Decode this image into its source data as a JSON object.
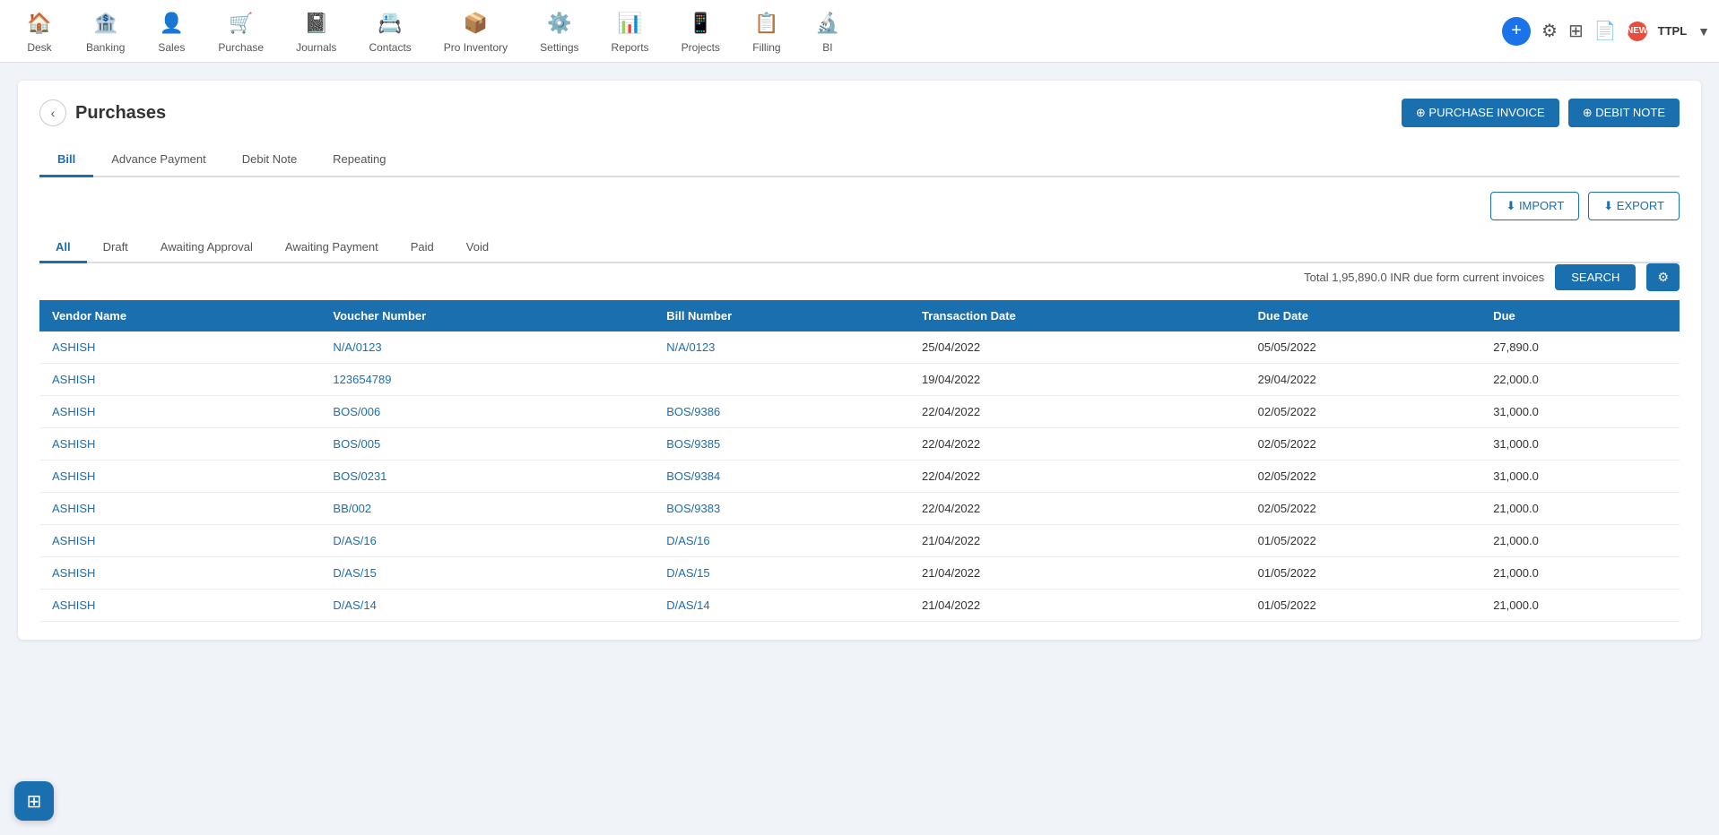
{
  "nav": {
    "items": [
      {
        "id": "desk",
        "label": "Desk",
        "icon": "🏠"
      },
      {
        "id": "banking",
        "label": "Banking",
        "icon": "🏦"
      },
      {
        "id": "sales",
        "label": "Sales",
        "icon": "👤"
      },
      {
        "id": "purchase",
        "label": "Purchase",
        "icon": "🛒"
      },
      {
        "id": "journals",
        "label": "Journals",
        "icon": "📓"
      },
      {
        "id": "contacts",
        "label": "Contacts",
        "icon": "📇"
      },
      {
        "id": "pro-inventory",
        "label": "Pro Inventory",
        "icon": "📦"
      },
      {
        "id": "settings",
        "label": "Settings",
        "icon": "⚙️"
      },
      {
        "id": "reports",
        "label": "Reports",
        "icon": "📊"
      },
      {
        "id": "projects",
        "label": "Projects",
        "icon": "📱"
      },
      {
        "id": "filling",
        "label": "Filling",
        "icon": "📋"
      },
      {
        "id": "bi",
        "label": "BI",
        "icon": "🔬"
      }
    ],
    "right": {
      "company": "TTPL",
      "new_badge": "NEW"
    }
  },
  "page": {
    "title": "Purchases",
    "back_label": "‹",
    "purchase_invoice_btn": "⊕ PURCHASE INVOICE",
    "debit_note_btn": "⊕ DEBIT NOTE"
  },
  "main_tabs": [
    {
      "id": "bill",
      "label": "Bill",
      "active": true
    },
    {
      "id": "advance-payment",
      "label": "Advance Payment",
      "active": false
    },
    {
      "id": "debit-note",
      "label": "Debit Note",
      "active": false
    },
    {
      "id": "repeating",
      "label": "Repeating",
      "active": false
    }
  ],
  "import_btn": "⬇ IMPORT",
  "export_btn": "⬇ EXPORT",
  "filter_tabs": [
    {
      "id": "all",
      "label": "All",
      "active": true
    },
    {
      "id": "draft",
      "label": "Draft",
      "active": false
    },
    {
      "id": "awaiting-approval",
      "label": "Awaiting Approval",
      "active": false
    },
    {
      "id": "awaiting-payment",
      "label": "Awaiting Payment",
      "active": false
    },
    {
      "id": "paid",
      "label": "Paid",
      "active": false
    },
    {
      "id": "void",
      "label": "Void",
      "active": false
    }
  ],
  "total_info": "Total 1,95,890.0 INR due form current invoices",
  "search_btn": "SEARCH",
  "settings_btn": "⚙",
  "table": {
    "headers": [
      "Vendor Name",
      "Voucher Number",
      "Bill Number",
      "Transaction Date",
      "Due Date",
      "Due"
    ],
    "rows": [
      {
        "vendor": "ASHISH",
        "voucher": "N/A/0123",
        "bill": "N/A/0123",
        "txn_date": "25/04/2022",
        "due_date": "05/05/2022",
        "due": "27,890.0"
      },
      {
        "vendor": "ASHISH",
        "voucher": "123654789",
        "bill": "",
        "txn_date": "19/04/2022",
        "due_date": "29/04/2022",
        "due": "22,000.0"
      },
      {
        "vendor": "ASHISH",
        "voucher": "BOS/006",
        "bill": "BOS/9386",
        "txn_date": "22/04/2022",
        "due_date": "02/05/2022",
        "due": "31,000.0"
      },
      {
        "vendor": "ASHISH",
        "voucher": "BOS/005",
        "bill": "BOS/9385",
        "txn_date": "22/04/2022",
        "due_date": "02/05/2022",
        "due": "31,000.0"
      },
      {
        "vendor": "ASHISH",
        "voucher": "BOS/0231",
        "bill": "BOS/9384",
        "txn_date": "22/04/2022",
        "due_date": "02/05/2022",
        "due": "31,000.0"
      },
      {
        "vendor": "ASHISH",
        "voucher": "BB/002",
        "bill": "BOS/9383",
        "txn_date": "22/04/2022",
        "due_date": "02/05/2022",
        "due": "21,000.0"
      },
      {
        "vendor": "ASHISH",
        "voucher": "D/AS/16",
        "bill": "D/AS/16",
        "txn_date": "21/04/2022",
        "due_date": "01/05/2022",
        "due": "21,000.0"
      },
      {
        "vendor": "ASHISH",
        "voucher": "D/AS/15",
        "bill": "D/AS/15",
        "txn_date": "21/04/2022",
        "due_date": "01/05/2022",
        "due": "21,000.0"
      },
      {
        "vendor": "ASHISH",
        "voucher": "D/AS/14",
        "bill": "D/AS/14",
        "txn_date": "21/04/2022",
        "due_date": "01/05/2022",
        "due": "21,000.0"
      }
    ]
  }
}
